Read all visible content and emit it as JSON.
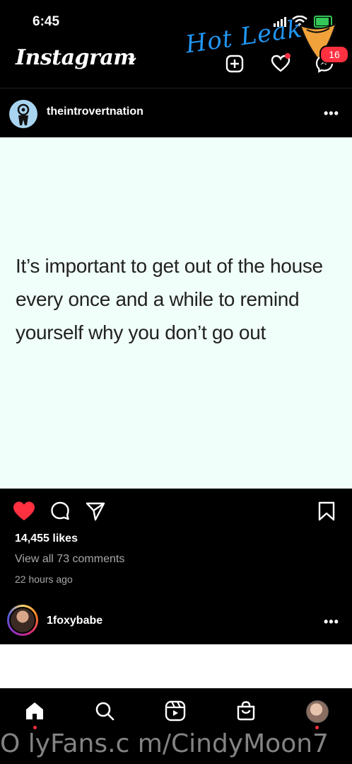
{
  "status_bar": {
    "time": "6:45"
  },
  "watermark_top": "Hot Leak",
  "header": {
    "logo": "Instagram",
    "notification_badge": "16"
  },
  "post": {
    "username": "theintrovertnation",
    "more": "•••",
    "quote": "It’s important to get out of the house every once and a while to remind yourself why you don’t go out",
    "likes": "14,455 likes",
    "comments_link": "View all 73 comments",
    "time_ago": "22 hours ago",
    "liked": true
  },
  "next_post": {
    "username": "1foxybabe",
    "more": "•••"
  },
  "tab_bar": {
    "items": [
      "home-icon",
      "search-icon",
      "reels-icon",
      "shop-icon",
      "profile-avatar"
    ]
  },
  "footer_watermark": "O lyFans.c m/CindyMoon7",
  "colors": {
    "accent_red": "#ff3040",
    "watermark_blue": "#2196f3",
    "post_bg": "#f0fff9"
  }
}
